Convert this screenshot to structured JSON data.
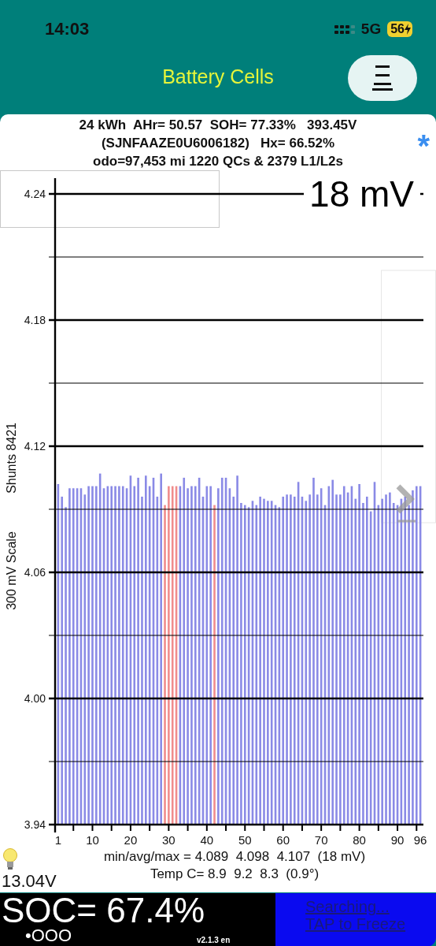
{
  "status_bar": {
    "time": "14:03",
    "network": "5G",
    "battery": "56"
  },
  "header": {
    "title": "Battery Cells"
  },
  "summary": {
    "lines": [
      "24 kWh  AHr= 50.57  SOH= 77.33%   393.45V",
      "(SJNFAAZE0U6006182)   Hx= 66.52%",
      "odo=97,453 mi 1220 QCs & 2379 L1/L2s"
    ],
    "asterisk": "*"
  },
  "chart": {
    "spread": "18 mV",
    "shunts": "Shunts 8421",
    "chart_data": {
      "type": "bar",
      "ylabel": "300 mV Scale",
      "x": [
        1,
        2,
        3,
        4,
        5,
        6,
        7,
        8,
        9,
        10,
        11,
        12,
        13,
        14,
        15,
        16,
        17,
        18,
        19,
        20,
        21,
        22,
        23,
        24,
        25,
        26,
        27,
        28,
        29,
        30,
        31,
        32,
        33,
        34,
        35,
        36,
        37,
        38,
        39,
        40,
        41,
        42,
        43,
        44,
        45,
        46,
        47,
        48,
        49,
        50,
        51,
        52,
        53,
        54,
        55,
        56,
        57,
        58,
        59,
        60,
        61,
        62,
        63,
        64,
        65,
        66,
        67,
        68,
        69,
        70,
        71,
        72,
        73,
        74,
        75,
        76,
        77,
        78,
        79,
        80,
        81,
        82,
        83,
        84,
        85,
        86,
        87,
        88,
        89,
        90,
        91,
        92,
        93,
        94,
        95,
        96
      ],
      "xlim": [
        0.2,
        96.8
      ],
      "ylim": [
        3.94,
        4.24
      ],
      "yticks": [
        {
          "value": 3.94,
          "label": "3.94"
        },
        {
          "value": 4.0,
          "label": "4.00"
        },
        {
          "value": 4.06,
          "label": "4.06"
        },
        {
          "value": 4.12,
          "label": "4.12"
        },
        {
          "value": 4.18,
          "label": "4.18"
        },
        {
          "value": 4.24,
          "label": "4.24"
        }
      ],
      "xticks": [
        1,
        10,
        20,
        30,
        40,
        50,
        60,
        70,
        80,
        90,
        96
      ],
      "grid": true,
      "series": [
        {
          "color": "#8a8ae6",
          "values": [
            4.102,
            4.096,
            4.091,
            4.1,
            4.1,
            4.1,
            4.1,
            4.097,
            4.101,
            4.101,
            4.101,
            4.107,
            4.1,
            4.101,
            4.101,
            4.101,
            4.101,
            4.101,
            4.1,
            4.106,
            4.101,
            4.105,
            4.096,
            4.106,
            4.101,
            4.105,
            4.096,
            4.107,
            null,
            null,
            null,
            null,
            4.101,
            4.105,
            4.1,
            4.101,
            4.101,
            4.105,
            4.096,
            4.101,
            4.101,
            null,
            4.1,
            4.105,
            4.105,
            4.1,
            4.096,
            4.106,
            4.093,
            4.092,
            4.091,
            4.094,
            4.092,
            4.096,
            4.095,
            4.094,
            4.094,
            4.092,
            4.091,
            4.096,
            4.097,
            4.097,
            4.096,
            4.103,
            4.096,
            4.094,
            4.097,
            4.105,
            4.097,
            4.1,
            4.092,
            4.101,
            4.104,
            4.097,
            4.097,
            4.101,
            4.098,
            4.101,
            4.095,
            4.102,
            4.093,
            4.096,
            4.089,
            4.103,
            4.092,
            4.095,
            4.097,
            4.098,
            4.093,
            4.092,
            4.095,
            4.096,
            4.092,
            4.099,
            4.101,
            4.101
          ]
        },
        {
          "color": "#f08c8c",
          "values": [
            null,
            null,
            null,
            null,
            null,
            null,
            null,
            null,
            null,
            null,
            null,
            null,
            null,
            null,
            null,
            null,
            null,
            null,
            null,
            null,
            null,
            null,
            null,
            null,
            null,
            null,
            null,
            null,
            4.092,
            4.101,
            4.101,
            4.101,
            null,
            null,
            null,
            null,
            null,
            null,
            null,
            null,
            null,
            4.092,
            null,
            null,
            null,
            null,
            null,
            null,
            null,
            null,
            null,
            null,
            null,
            null,
            null,
            null,
            null,
            null,
            null,
            null,
            null,
            null,
            null,
            null,
            null,
            null,
            null,
            null,
            null,
            null,
            null,
            null,
            null,
            null,
            null,
            null,
            null,
            null,
            null,
            null,
            null,
            null,
            null,
            null,
            null,
            null,
            null,
            null,
            null,
            null,
            null,
            null,
            null,
            null,
            null,
            null
          ]
        }
      ]
    }
  },
  "stats": {
    "voltage_line": "min/avg/max = 4.089  4.098  4.107  (18 mV)",
    "temp_line": "Temp C= 8.9  9.2  8.3  (0.9°)"
  },
  "aux_battery": "13.04V",
  "soc": {
    "text": "SOC= 67.4%",
    "dots": "•OOO",
    "version": "v2.1.3 en"
  },
  "connection": {
    "status": "Searching...",
    "action": "TAP to Freeze"
  }
}
